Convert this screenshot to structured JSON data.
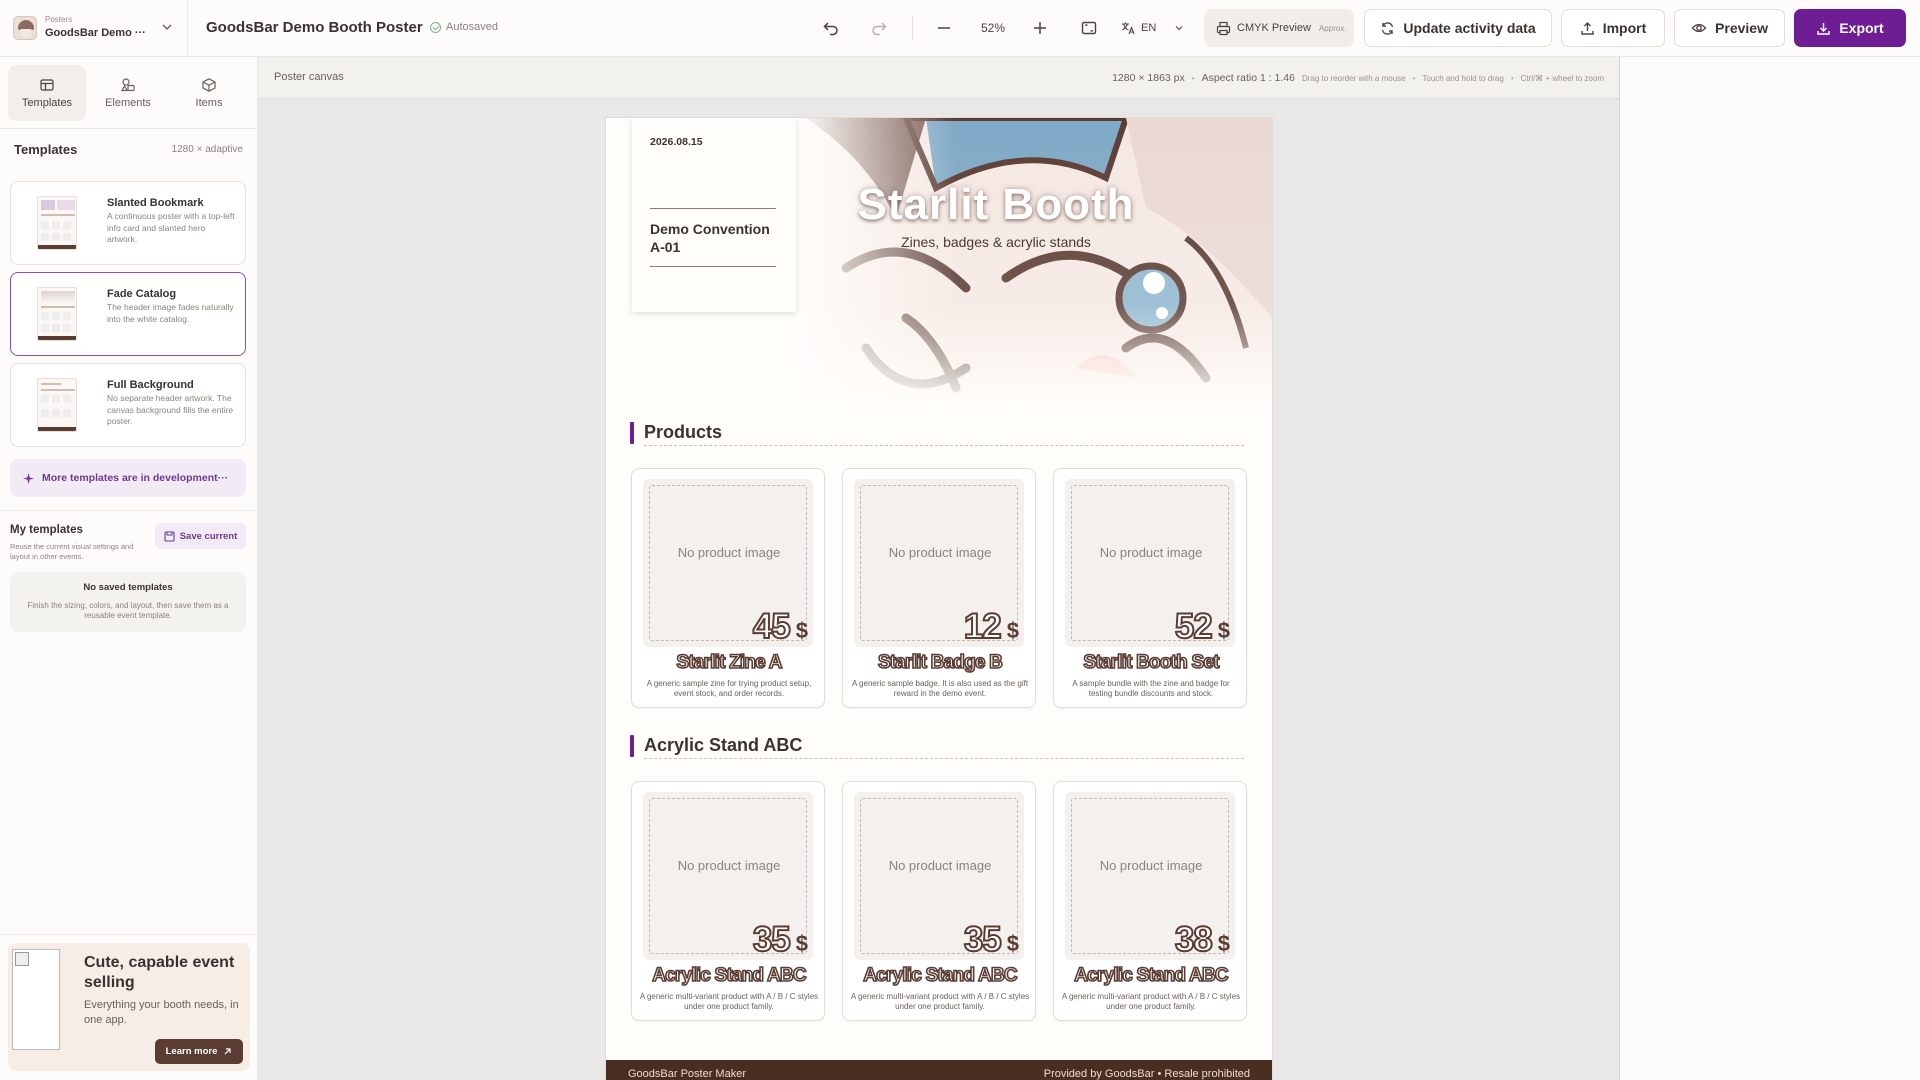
{
  "brand": {
    "kicker": "Posters",
    "name": "GoodsBar Demo ···"
  },
  "doc": {
    "title": "GoodsBar Demo Booth Poster",
    "status": "Autosaved"
  },
  "toolbar": {
    "zoom": "52%",
    "lang": "EN",
    "cmyk_label": "CMYK Preview",
    "cmyk_sub": "Approx.",
    "update_label": "Update activity data",
    "import_label": "Import",
    "preview_label": "Preview",
    "export_label": "Export",
    "export_color": "#6f1d94"
  },
  "sidebar": {
    "tabs": [
      {
        "label": "Templates",
        "icon": "layout-icon"
      },
      {
        "label": "Elements",
        "icon": "shapes-icon"
      },
      {
        "label": "Items",
        "icon": "box-icon"
      }
    ],
    "section_title": "Templates",
    "section_meta": "1280 × adaptive",
    "templates": [
      {
        "name": "Slanted Bookmark",
        "desc": "A continuous poster with a top-left info card and slanted hero artwork."
      },
      {
        "name": "Fade Catalog",
        "desc": "The header image fades naturally into the white catalog."
      },
      {
        "name": "Full Background",
        "desc": "No separate header artwork. The canvas background fills the entire poster."
      }
    ],
    "more_templates": "More templates are in development···",
    "my_templates": {
      "title": "My templates",
      "desc": "Reuse the current visual settings and layout in other events.",
      "save_label": "Save current",
      "empty_title": "No saved templates",
      "empty_desc": "Finish the sizing, colors, and layout, then save them as a reusable event template."
    },
    "promo": {
      "title": "Cute, capable event selling",
      "body": "Everything your booth needs, in one app.",
      "button": "Learn more"
    }
  },
  "canvas": {
    "label": "Poster canvas",
    "size": "1280 × 1863 px",
    "aspect": "Aspect ratio 1 : 1.46",
    "hint_drag": "Drag to reorder with a mouse",
    "hint_touch": "Touch and hold to drag",
    "hint_zoom": "Ctrl/⌘ + wheel to zoom"
  },
  "poster": {
    "date": "2026.08.15",
    "place": "Demo Convention A-01",
    "title": "Starlit Booth",
    "subtitle": "Zines, badges & acrylic stands",
    "no_image": "No product image",
    "currency": "$",
    "sections": [
      {
        "title": "Products",
        "products": [
          {
            "name": "Starlit Zine A",
            "price": "45",
            "desc": "A generic sample zine for trying product setup, event stock, and order records."
          },
          {
            "name": "Starlit Badge B",
            "price": "12",
            "desc": "A generic sample badge. It is also used as the gift reward in the demo event."
          },
          {
            "name": "Starlit Booth Set",
            "price": "52",
            "desc": "A sample bundle with the zine and badge for testing bundle discounts and stock."
          }
        ]
      },
      {
        "title": "Acrylic Stand ABC",
        "products": [
          {
            "name": "Acrylic Stand ABC",
            "price": "35",
            "desc": "A generic multi-variant product with A / B / C styles under one product family."
          },
          {
            "name": "Acrylic Stand ABC",
            "price": "35",
            "desc": "A generic multi-variant product with A / B / C styles under one product family."
          },
          {
            "name": "Acrylic Stand ABC",
            "price": "38",
            "desc": "A generic multi-variant product with A / B / C styles under one product family."
          }
        ]
      }
    ],
    "footer_left": "GoodsBar Poster Maker",
    "footer_right": "Provided by GoodsBar • Resale prohibited"
  }
}
